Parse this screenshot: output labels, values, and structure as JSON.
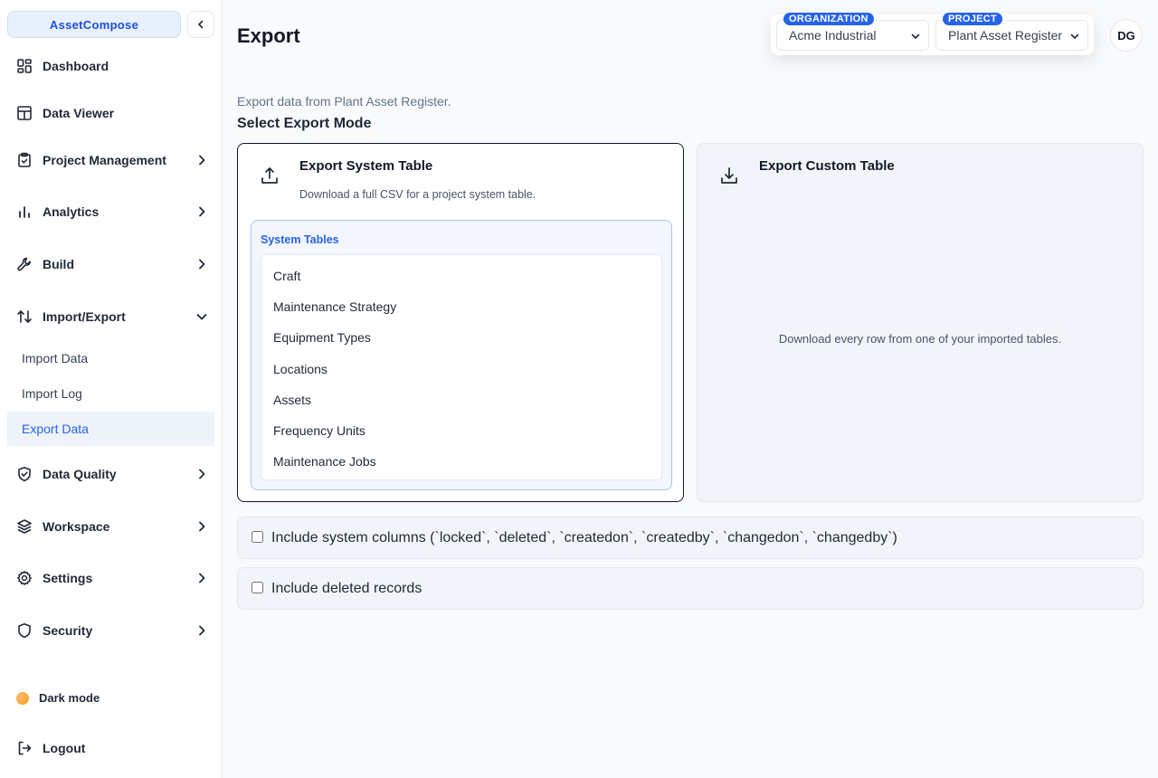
{
  "brand": {
    "name": "AssetCompose"
  },
  "sidebar": {
    "items": [
      {
        "label": "Dashboard",
        "icon": "dashboard-icon"
      },
      {
        "label": "Data Viewer",
        "icon": "table-icon"
      },
      {
        "label": "Project Management",
        "icon": "clipboard-icon"
      },
      {
        "label": "Analytics",
        "icon": "bar-chart-icon"
      },
      {
        "label": "Build",
        "icon": "wrench-icon"
      },
      {
        "label": "Import/Export",
        "icon": "arrows-up-down-icon"
      },
      {
        "label": "Data Quality",
        "icon": "shield-check-icon"
      },
      {
        "label": "Workspace",
        "icon": "layers-icon"
      },
      {
        "label": "Settings",
        "icon": "gear-icon"
      },
      {
        "label": "Security",
        "icon": "shield-icon"
      }
    ],
    "import_export_subitems": [
      {
        "label": "Import Data"
      },
      {
        "label": "Import Log"
      },
      {
        "label": "Export Data",
        "active": true
      }
    ],
    "dark_mode_label": "Dark mode",
    "logout_label": "Logout"
  },
  "header": {
    "title": "Export",
    "organization": {
      "badge": "ORGANIZATION",
      "value": "Acme Industrial"
    },
    "project": {
      "badge": "PROJECT",
      "value": "Plant Asset Register"
    },
    "avatar_initials": "DG"
  },
  "main": {
    "subtitle": "Export data from Plant Asset Register.",
    "section_heading": "Select Export Mode",
    "system_card": {
      "title": "Export System Table",
      "description": "Download a full CSV for a project system table.",
      "tables_label": "System Tables",
      "tables": [
        "Craft",
        "Maintenance Strategy",
        "Equipment Types",
        "Locations",
        "Assets",
        "Frequency Units",
        "Maintenance Jobs"
      ]
    },
    "custom_card": {
      "title": "Export Custom Table",
      "description": "Download every row from one of your imported tables."
    },
    "options": {
      "system_columns_label": "Include system columns (`locked`, `deleted`, `createdon`, `createdby`, `changedon`, `changedby`)",
      "deleted_records_label": "Include deleted records"
    }
  },
  "colors": {
    "accent": "#2563eb",
    "active_bg": "#eef2f9"
  }
}
